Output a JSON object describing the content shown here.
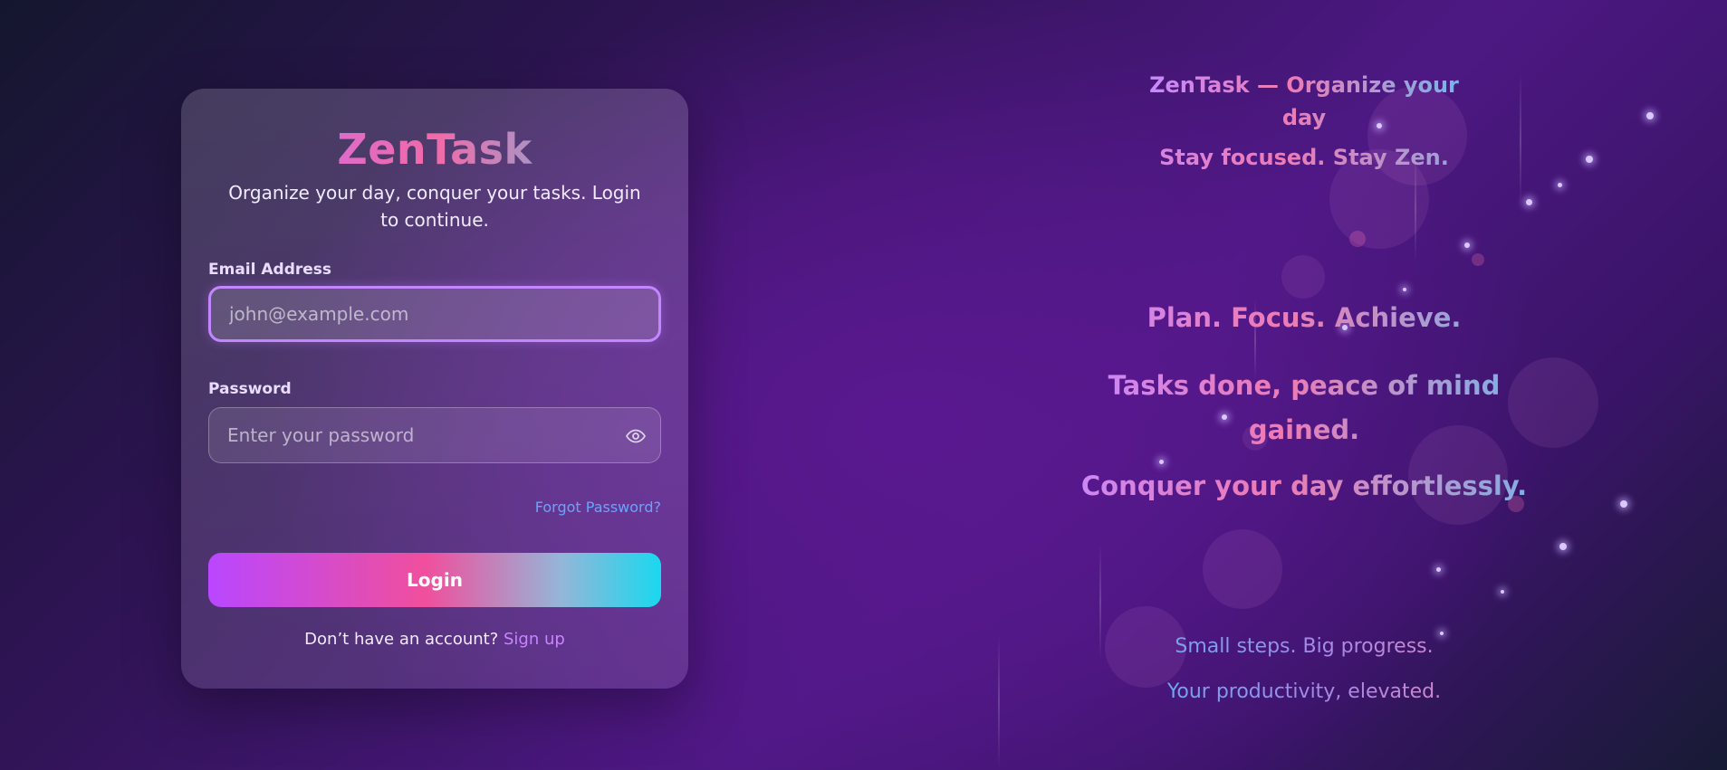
{
  "login_card": {
    "brand": "ZenTask",
    "subtitle": "Organize your day, conquer your tasks. Login to continue.",
    "email": {
      "label": "Email Address",
      "value": "",
      "placeholder": "john@example.com"
    },
    "password": {
      "label": "Password",
      "value": "",
      "placeholder": "Enter your password",
      "toggle_icon": "eye-icon"
    },
    "forgot_password": "Forgot Password?",
    "login_button": "Login",
    "signup_prompt": "Don’t have an account?",
    "signup_link": "Sign up"
  },
  "hero": {
    "title": "ZenTask — Organize your day",
    "tagline": "Stay focused. Stay Zen.",
    "slogans": [
      "Plan. Focus. Achieve.",
      "Tasks done, peace of mind gained.",
      "Conquer your day effortlessly."
    ],
    "footer_lines": [
      "Small steps. Big progress.",
      "Your productivity, elevated."
    ]
  },
  "colors": {
    "accent_purple": "#b947ff",
    "accent_pink": "#f04f9c",
    "accent_cyan": "#1ad8ef",
    "link_blue": "#62a7ff"
  }
}
